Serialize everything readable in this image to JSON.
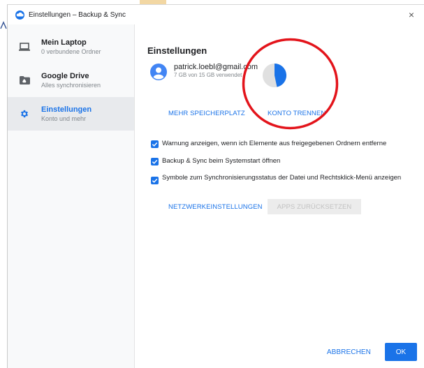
{
  "window": {
    "title": "Einstellungen – Backup & Sync",
    "close_glyph": "×"
  },
  "sidebar": {
    "items": [
      {
        "title": "Mein Laptop",
        "subtitle": "0 verbundene Ordner",
        "icon": "laptop-icon",
        "active": false
      },
      {
        "title": "Google Drive",
        "subtitle": "Alles synchronisieren",
        "icon": "drive-folder-icon",
        "active": false
      },
      {
        "title": "Einstellungen",
        "subtitle": "Konto und mehr",
        "icon": "gear-icon",
        "active": true
      }
    ]
  },
  "main": {
    "heading": "Einstellungen",
    "account": {
      "email": "patrick.loebl@gmail.com",
      "storage": "7 GB von 15 GB verwendet",
      "storage_used_fraction": 0.467
    },
    "more_storage_label": "MEHR SPEICHERPLATZ",
    "disconnect_label": "KONTO TRENNEN",
    "checkboxes": [
      {
        "label": "Warnung anzeigen, wenn ich Elemente aus freigegebenen Ordnern entferne",
        "checked": true
      },
      {
        "label": "Backup & Sync beim Systemstart öffnen",
        "checked": true
      },
      {
        "label": "Symbole zum Synchronisierungsstatus der Datei und Rechtsklick-Menü anzeigen",
        "checked": true
      }
    ],
    "network_label": "NETZWERKEINSTELLUNGEN",
    "reset_apps_label": "APPS ZURÜCKSETZEN"
  },
  "footer": {
    "cancel_label": "ABBRECHEN",
    "ok_label": "OK"
  },
  "colors": {
    "accent": "#1a73e8",
    "annotation_circle": "#e3141b",
    "sidebar_bg": "#f8f9fa",
    "active_item_bg": "#e8eaed"
  }
}
